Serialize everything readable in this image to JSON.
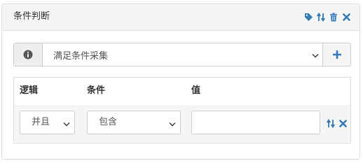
{
  "panel": {
    "title": "条件判断",
    "tools": [
      "tag-icon",
      "sort-icon",
      "trash-icon",
      "close-icon"
    ]
  },
  "colors": {
    "accent": "#337ab7",
    "heading_bg": "#f5f5f5",
    "border": "#dddddd",
    "addon_bg": "#eeeeee",
    "row_bg": "#f5f5f5"
  },
  "mode_select": {
    "icon": "info-icon",
    "value": "满足条件采集",
    "add_icon": "plus-icon"
  },
  "conditions": {
    "headers": {
      "logic": "逻辑",
      "condition": "条件",
      "value": "值"
    },
    "rows": [
      {
        "logic": "并且",
        "operator": "包含",
        "value": "",
        "tools": [
          "sort-icon",
          "close-icon"
        ]
      }
    ]
  }
}
